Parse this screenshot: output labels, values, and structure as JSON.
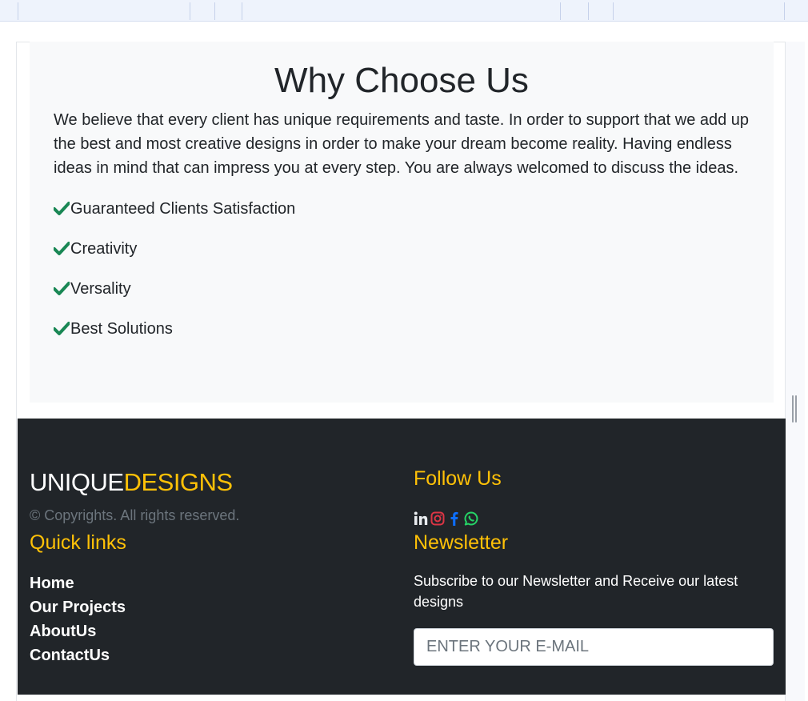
{
  "why_choose": {
    "title": "Why Choose Us",
    "description": "We believe that every client has unique requirements and taste. In order to support that we add up the best and most creative designs in order to make your dream become reality. Having endless ideas in mind that can impress you at every step. You are always welcomed to discuss the ideas.",
    "features": [
      "Guaranteed Clients Satisfaction",
      "Creativity",
      "Versality",
      "Best Solutions"
    ],
    "check_color": "#198754"
  },
  "footer": {
    "brand_part1": "UNIQUE",
    "brand_part2": "DESIGNS",
    "copyright": "© Copyrights. All rights reserved.",
    "quick_links_title": "Quick links",
    "links": [
      "Home",
      "Our Projects",
      "AboutUs",
      "ContactUs"
    ],
    "follow_title": "Follow Us",
    "social_icons": [
      "linkedin-icon",
      "instagram-icon",
      "facebook-icon",
      "whatsapp-icon"
    ],
    "newsletter_title": "Newsletter",
    "newsletter_text": "Subscribe to our Newsletter and Receive our latest designs",
    "email_placeholder": "ENTER YOUR E-MAIL",
    "accent_color": "#ffc107",
    "background_color": "#212529"
  }
}
